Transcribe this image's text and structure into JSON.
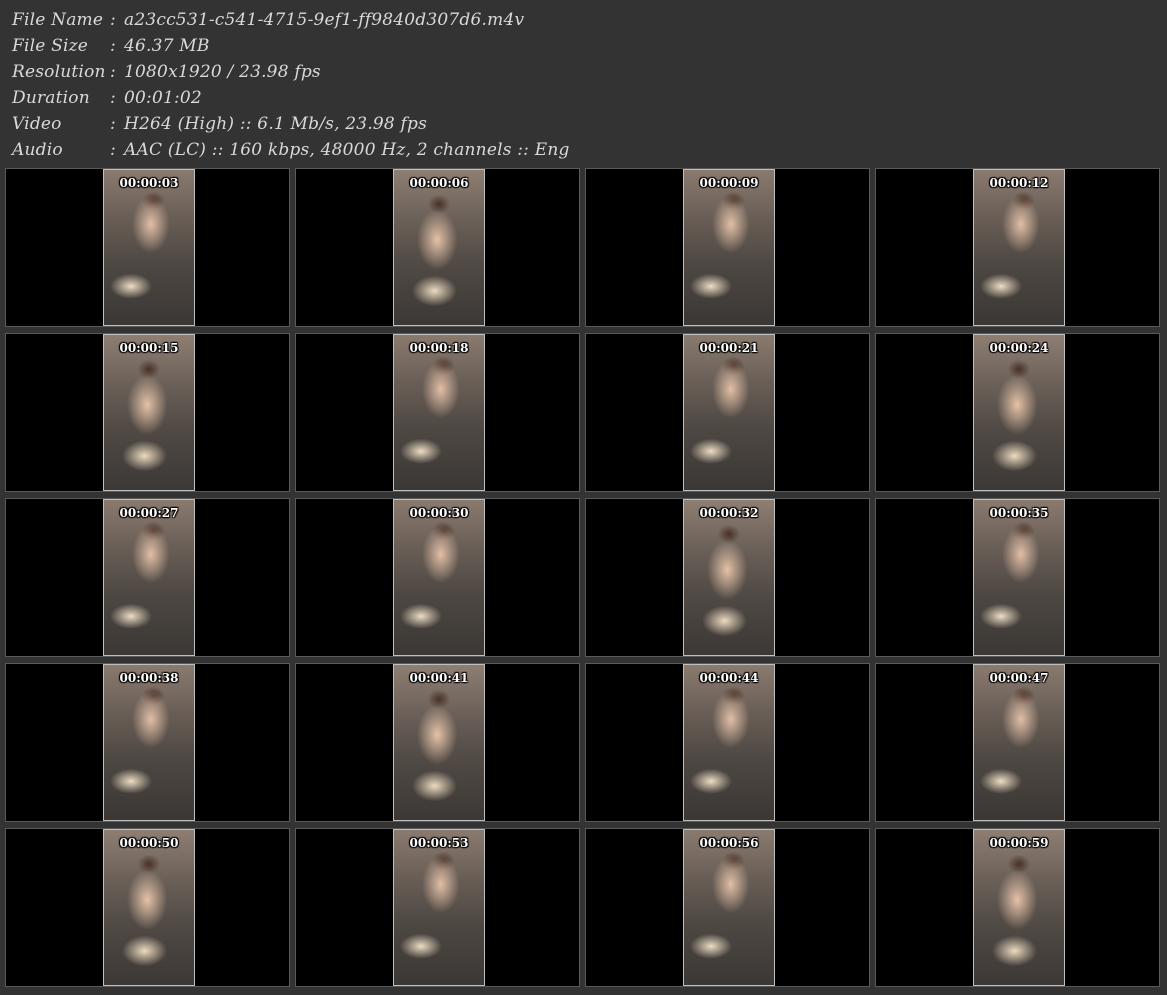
{
  "info": [
    {
      "key": "File Name",
      "sep": ":",
      "value": "a23cc531-c541-4715-9ef1-ff9840d307d6.m4v"
    },
    {
      "key": "File Size",
      "sep": ":",
      "value": "46.37 MB"
    },
    {
      "key": "Resolution",
      "sep": ":",
      "value": "1080x1920 / 23.98 fps"
    },
    {
      "key": "Duration",
      "sep": ":",
      "value": "00:01:02"
    },
    {
      "key": "Video",
      "sep": ":",
      "value": "H264 (High) :: 6.1 Mb/s, 23.98 fps"
    },
    {
      "key": "Audio",
      "sep": ":",
      "value": "AAC (LC) :: 160 kbps, 48000 Hz, 2 channels :: Eng"
    }
  ],
  "thumbnails": [
    "00:00:03",
    "00:00:06",
    "00:00:09",
    "00:00:12",
    "00:00:15",
    "00:00:18",
    "00:00:21",
    "00:00:24",
    "00:00:27",
    "00:00:30",
    "00:00:32",
    "00:00:35",
    "00:00:38",
    "00:00:41",
    "00:00:44",
    "00:00:47",
    "00:00:50",
    "00:00:53",
    "00:00:56",
    "00:00:59"
  ]
}
